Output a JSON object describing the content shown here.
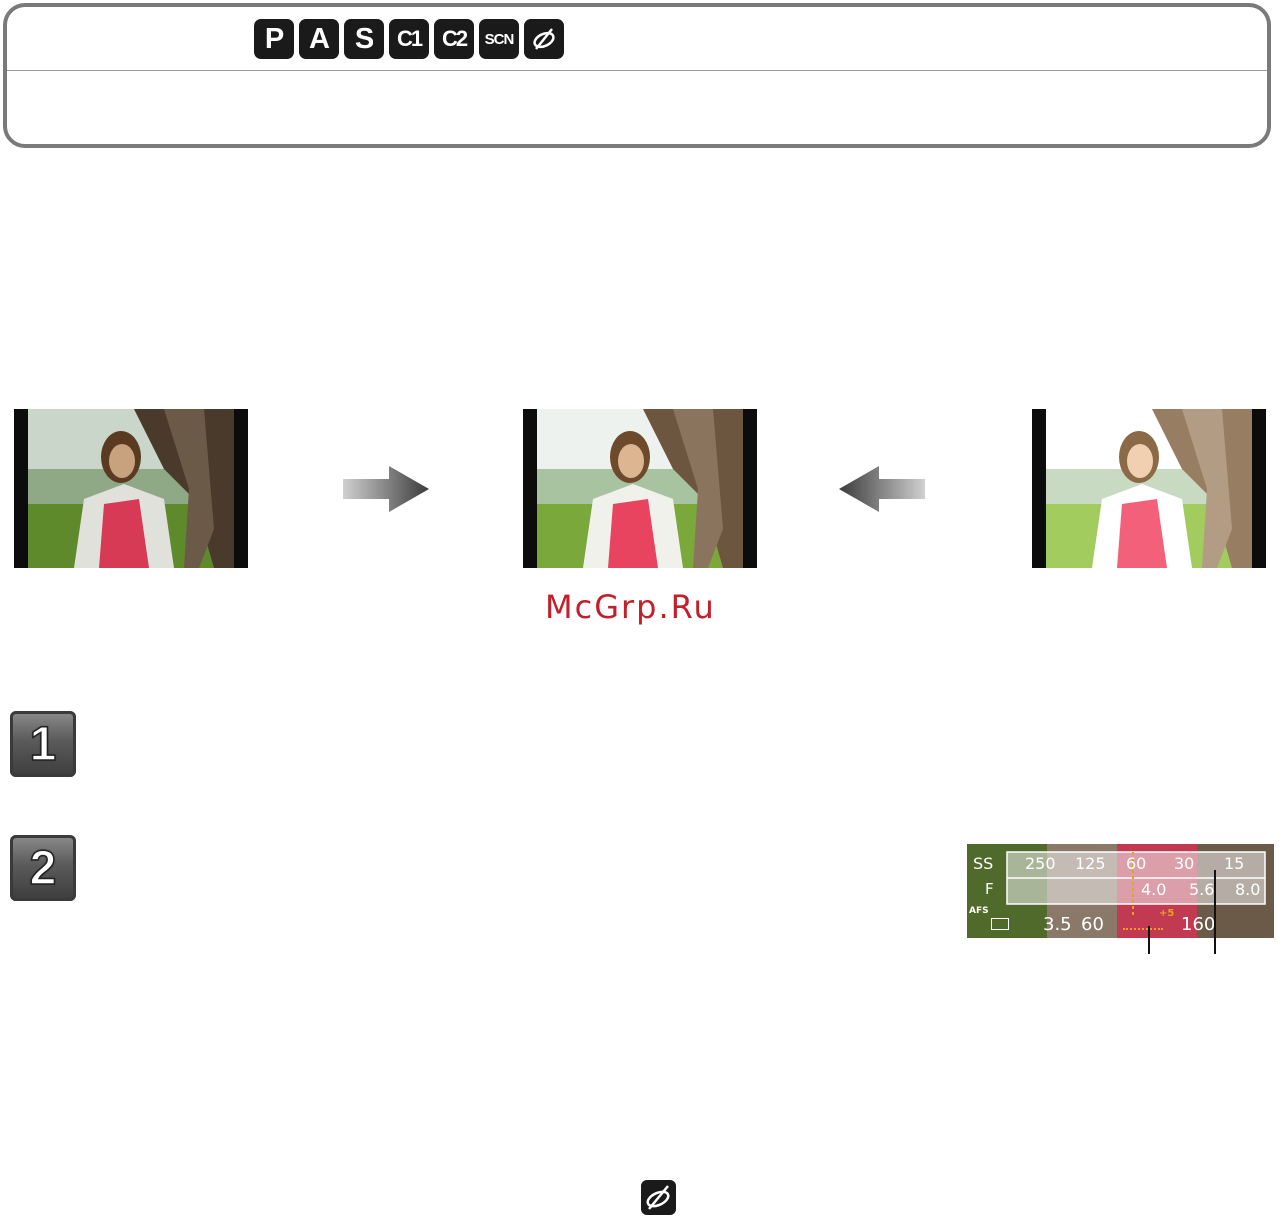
{
  "header": {
    "mode_icons": [
      {
        "label": "P",
        "size": "lg"
      },
      {
        "label": "A",
        "size": "lg"
      },
      {
        "label": "S",
        "size": "lg"
      },
      {
        "label": "C1",
        "size": "sm"
      },
      {
        "label": "C2",
        "size": "sm"
      },
      {
        "label": "SCN",
        "size": "xs"
      }
    ],
    "creative_icon": "creative-control-icon"
  },
  "watermark": "McGrp.Ru",
  "steps": [
    "1",
    "2"
  ],
  "lcd": {
    "ss_label": "SS",
    "f_label": "F",
    "ss_scale": [
      "250",
      "125",
      "60",
      "30",
      "15"
    ],
    "f_scale": [
      "4.0",
      "5.6",
      "8.0"
    ],
    "afs_label": "AFS",
    "aperture_value": "3.5",
    "shutter_value": "60",
    "iso_value": "160",
    "ev_label": "+5"
  },
  "colors": {
    "frame_border": "#7a7a7a",
    "watermark": "#c21f2b",
    "lcd_highlight": "#e8a020"
  }
}
